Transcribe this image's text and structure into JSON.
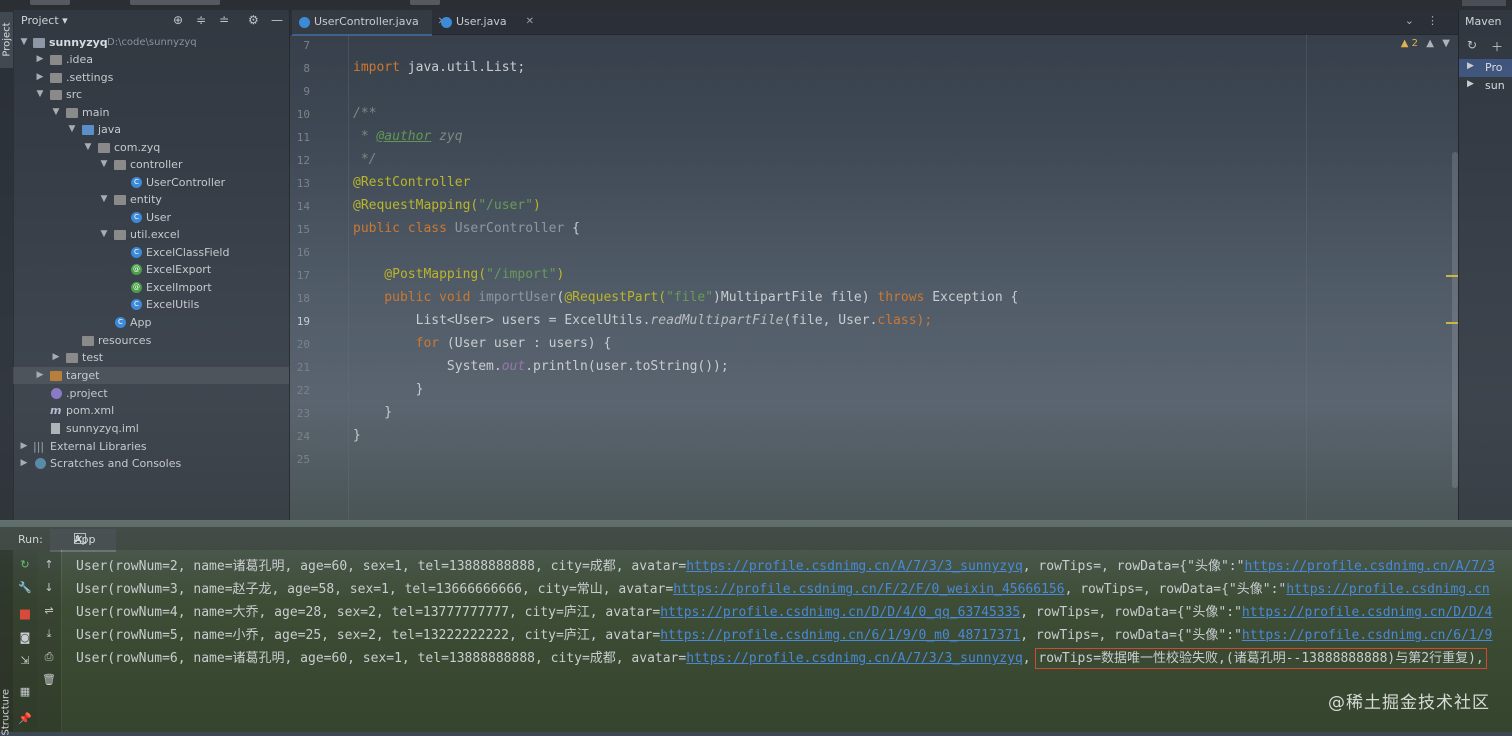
{
  "sidebar_tab": "Project",
  "project": {
    "header_title": "Project",
    "root_name": "sunnyzyq",
    "root_path": "D:\\code\\sunnyzyq",
    "tree": [
      {
        "label": "sunnyzyq"
      },
      {
        "label": ".idea"
      },
      {
        "label": ".settings"
      },
      {
        "label": "src"
      },
      {
        "label": "main"
      },
      {
        "label": "java"
      },
      {
        "label": "com.zyq"
      },
      {
        "label": "controller"
      },
      {
        "label": "UserController"
      },
      {
        "label": "entity"
      },
      {
        "label": "User"
      },
      {
        "label": "util.excel"
      },
      {
        "label": "ExcelClassField"
      },
      {
        "label": "ExcelExport"
      },
      {
        "label": "ExcelImport"
      },
      {
        "label": "ExcelUtils"
      },
      {
        "label": "App"
      },
      {
        "label": "resources"
      },
      {
        "label": "test"
      },
      {
        "label": "target"
      },
      {
        "label": ".project"
      },
      {
        "label": "pom.xml"
      },
      {
        "label": "sunnyzyq.iml"
      },
      {
        "label": "External Libraries"
      },
      {
        "label": "Scratches and Consoles"
      }
    ]
  },
  "tabs": [
    {
      "label": "UserController.java"
    },
    {
      "label": "User.java"
    }
  ],
  "editor": {
    "warning_count": "2",
    "lines": [
      "7",
      "8",
      "9",
      "10",
      "11",
      "12",
      "13",
      "14",
      "15",
      "16",
      "17",
      "18",
      "19",
      "20",
      "21",
      "22",
      "23",
      "24",
      "25"
    ],
    "code": {
      "l8a": "import",
      "l8b": " java.util.List;",
      "l10": "/**",
      "l11a": " * ",
      "l11b": "@author",
      "l11c": " zyq",
      "l12": " */",
      "l13": "@RestController",
      "l14a": "@RequestMapping(",
      "l14b": "\"/user\"",
      "l14c": ")",
      "l15a": "public class",
      "l15b": " UserController",
      "l15c": " {",
      "l17a": "    @PostMapping(",
      "l17b": "\"/import\"",
      "l17c": ")",
      "l18a": "    public void",
      "l18b": " importUser",
      "l18c": "(",
      "l18d": "@RequestPart(",
      "l18e": "\"file\"",
      "l18f": ")MultipartFile file) ",
      "l18g": "throws",
      "l18h": " Exception {",
      "l19a": "        List<User> users = ExcelUtils.",
      "l19b": "readMultipartFile",
      "l19c": "(file, User.",
      "l19d": "class",
      "l19e": ");",
      "l20a": "        for",
      "l20b": " (User user : users) {",
      "l21a": "            System.",
      "l21b": "out",
      "l21c": ".println(user.toString());",
      "l22": "        }",
      "l23": "    }",
      "l24": "}"
    }
  },
  "maven": {
    "title": "Maven",
    "items": [
      "Pro",
      "sun"
    ]
  },
  "run": {
    "label": "Run:",
    "tab": "App",
    "lines": [
      {
        "pre": "User(rowNum=2, name=诸葛孔明, age=60, sex=1, tel=13888888888, city=成都, avatar=",
        "link": "https://profile.csdnimg.cn/A/7/3/3_sunnyzyq",
        "post": ", rowTips=, rowData={\"头像\":\"",
        "link2": "https://profile.csdnimg.cn/A/7/3"
      },
      {
        "pre": "User(rowNum=3, name=赵子龙, age=58, sex=1, tel=13666666666, city=常山, avatar=",
        "link": "https://profile.csdnimg.cn/F/2/F/0_weixin_45666156",
        "post": ", rowTips=, rowData={\"头像\":\"",
        "link2": "https://profile.csdnimg.cn"
      },
      {
        "pre": "User(rowNum=4, name=大乔, age=28, sex=2, tel=13777777777, city=庐江, avatar=",
        "link": "https://profile.csdnimg.cn/D/D/4/0_qq_63745335",
        "post": ", rowTips=, rowData={\"头像\":\"",
        "link2": "https://profile.csdnimg.cn/D/D/4"
      },
      {
        "pre": "User(rowNum=5, name=小乔, age=25, sex=2, tel=13222222222, city=庐江, avatar=",
        "link": "https://profile.csdnimg.cn/6/1/9/0_m0_48717371",
        "post": ", rowTips=, rowData={\"头像\":\"",
        "link2": "https://profile.csdnimg.cn/6/1/9"
      },
      {
        "pre": "User(rowNum=6, name=诸葛孔明, age=60, sex=1, tel=13888888888, city=成都, avatar=",
        "link": "https://profile.csdnimg.cn/A/7/3/3_sunnyzyq",
        "post": ", ",
        "highlight": "rowTips=数据唯一性校验失败,(诸葛孔明--13888888888)与第2行重复),"
      }
    ],
    "side_tab": "Structure"
  },
  "watermark": "@稀土掘金技术社区"
}
